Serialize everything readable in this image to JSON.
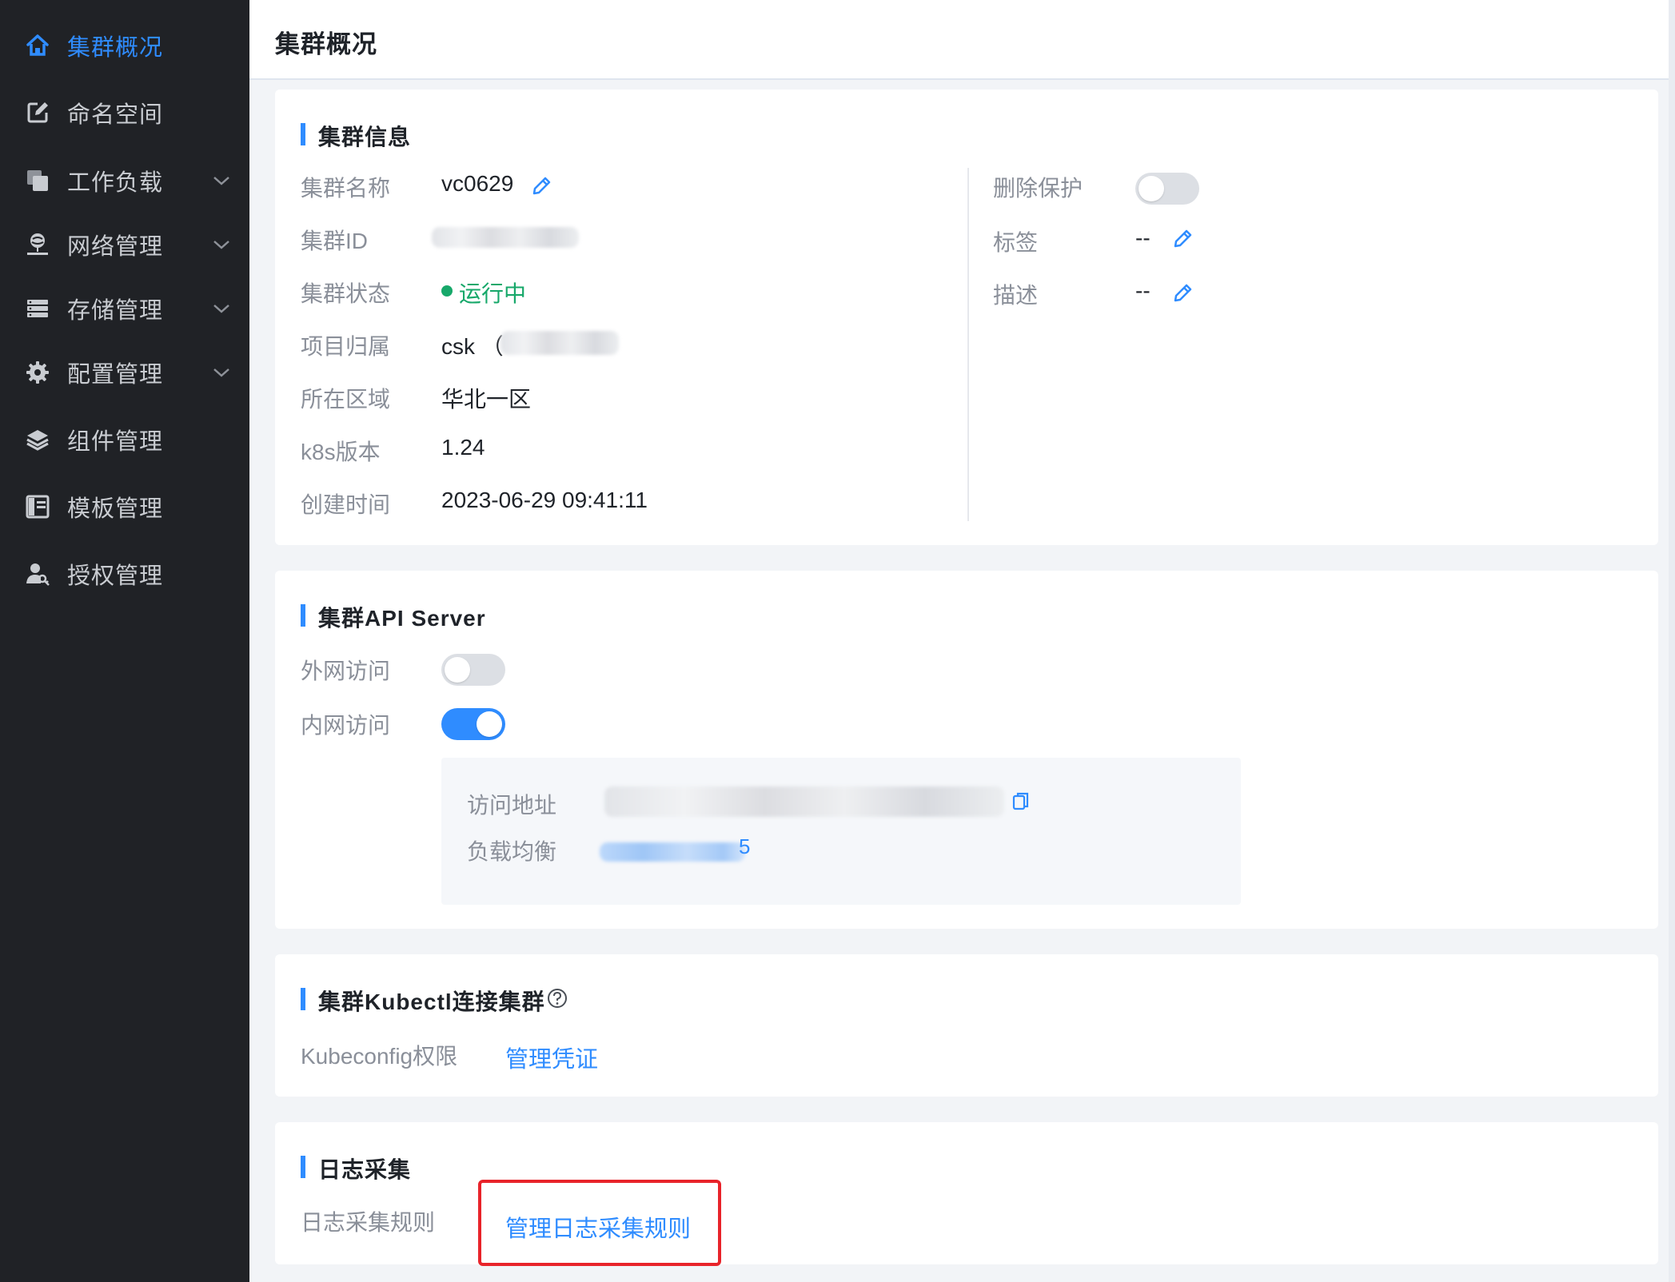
{
  "sidebar": {
    "items": [
      {
        "label": "集群概况",
        "icon": "home-icon",
        "active": true
      },
      {
        "label": "命名空间",
        "icon": "edit-box-icon"
      },
      {
        "label": "工作负载",
        "icon": "layers-icon",
        "expandable": true
      },
      {
        "label": "网络管理",
        "icon": "network-icon",
        "expandable": true
      },
      {
        "label": "存储管理",
        "icon": "storage-icon",
        "expandable": true
      },
      {
        "label": "配置管理",
        "icon": "gear-icon",
        "expandable": true
      },
      {
        "label": "组件管理",
        "icon": "stack-icon"
      },
      {
        "label": "模板管理",
        "icon": "template-icon"
      },
      {
        "label": "授权管理",
        "icon": "user-key-icon"
      }
    ],
    "active_color": "#2f8cff"
  },
  "header": {
    "title": "集群概况"
  },
  "cluster_info": {
    "title": "集群信息",
    "name_label": "集群名称",
    "name_value": "vc0629",
    "id_label": "集群ID",
    "status_label": "集群状态",
    "status_value": "运行中",
    "project_label": "项目归属",
    "project_value": "csk （",
    "region_label": "所在区域",
    "region_value": "华北一区",
    "k8s_label": "k8s版本",
    "k8s_value": "1.24",
    "created_label": "创建时间",
    "created_value": "2023-06-29 09:41:11",
    "delete_protect_label": "删除保护",
    "delete_protect_on": false,
    "tags_label": "标签",
    "tags_value": "--",
    "desc_label": "描述",
    "desc_value": "--"
  },
  "api_server": {
    "title": "集群API Server",
    "public_label": "外网访问",
    "public_on": false,
    "private_label": "内网访问",
    "private_on": true,
    "address_label": "访问地址",
    "lb_label": "负载均衡",
    "lb_suffix": "5"
  },
  "kubectl": {
    "title": "集群Kubectl连接集群",
    "kubeconfig_label": "Kubeconfig权限",
    "manage_link": "管理凭证"
  },
  "logging": {
    "title": "日志采集",
    "rules_label": "日志采集规则",
    "manage_link": "管理日志采集规则"
  },
  "colors": {
    "accent": "#2f8cff",
    "running": "#17a86a",
    "highlight": "#e8232a",
    "sidebar_bg": "#202226"
  }
}
